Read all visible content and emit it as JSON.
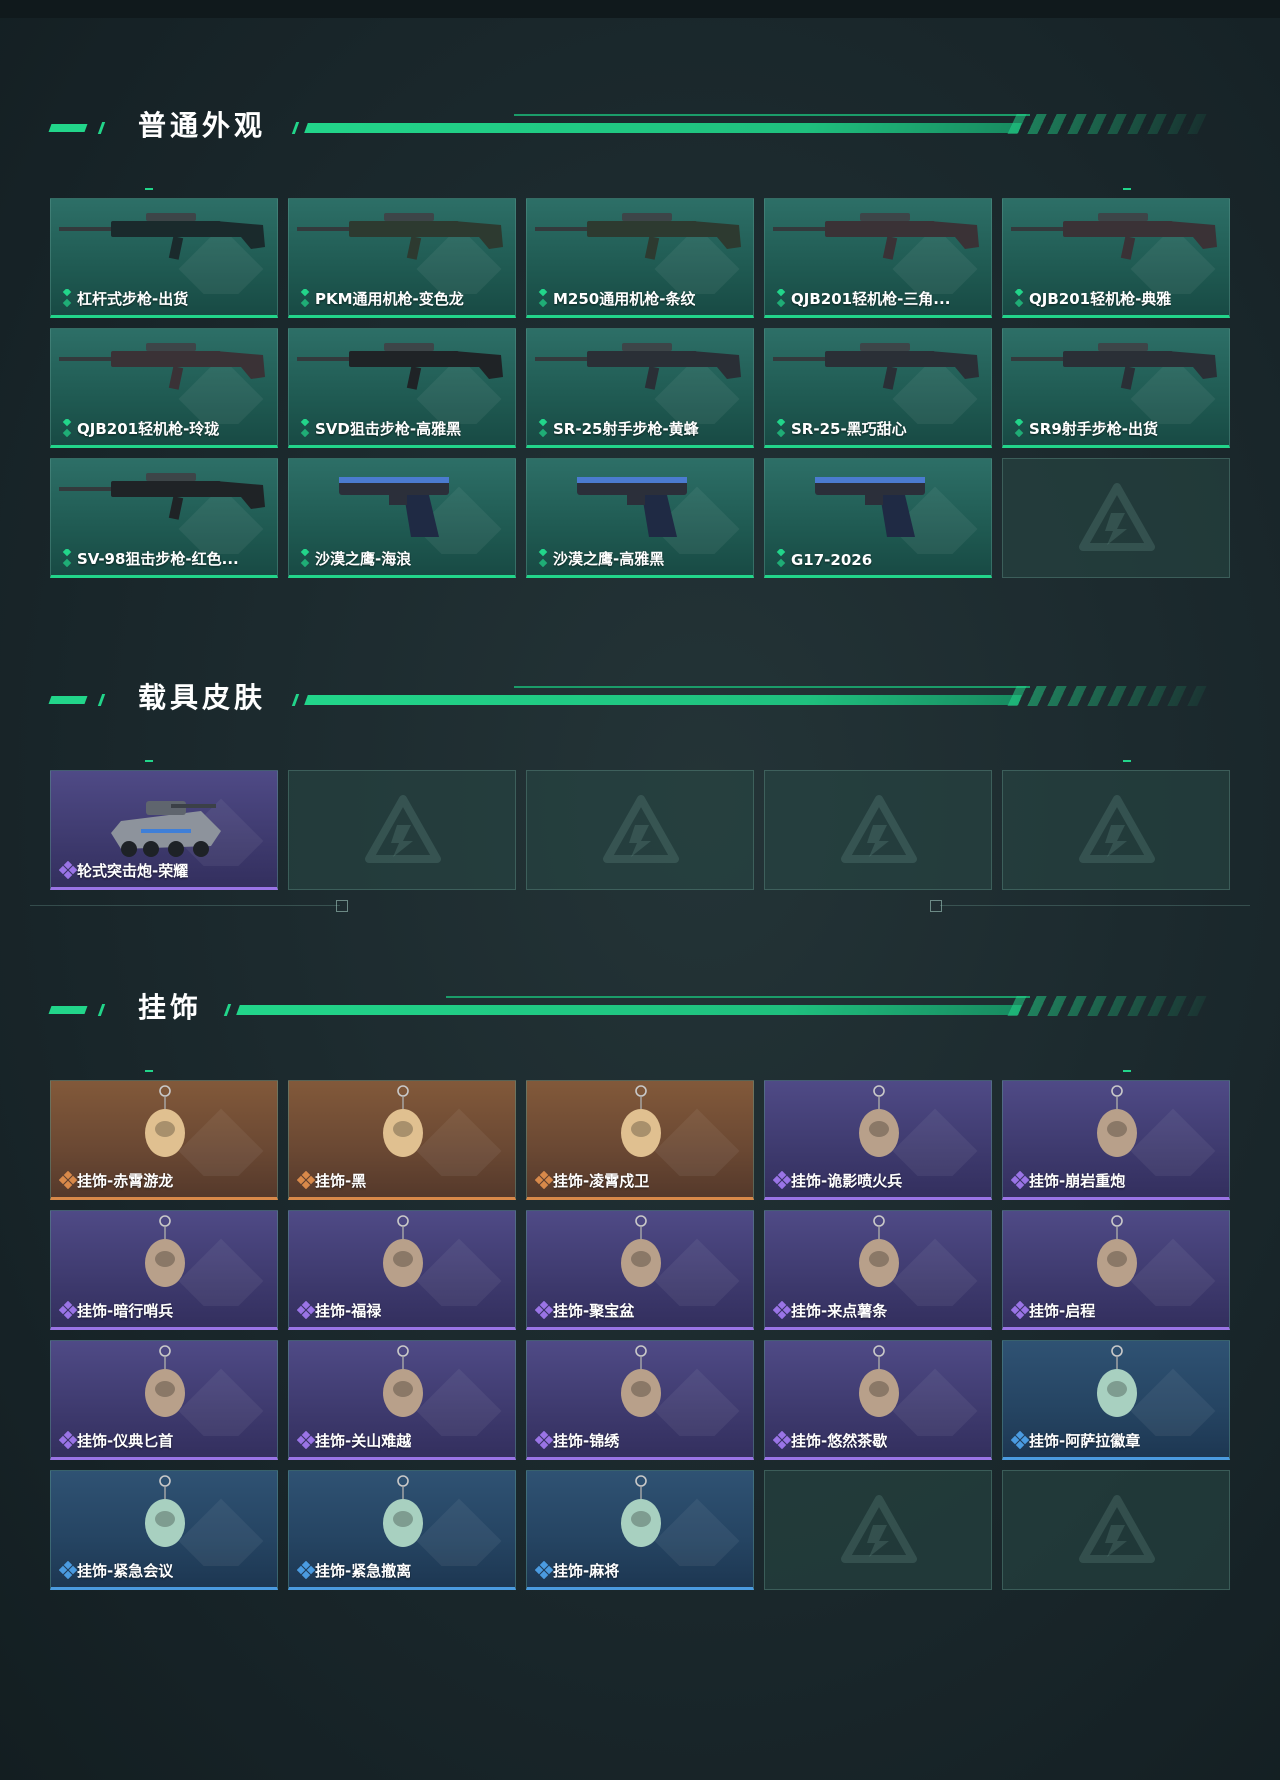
{
  "sections": [
    {
      "title": "普通外观",
      "items": [
        {
          "label": "杠杆式步枪-出货",
          "rarity": "green",
          "icon": "lever-rifle-icon"
        },
        {
          "label": "PKM通用机枪-变色龙",
          "rarity": "green",
          "icon": "machine-gun-icon"
        },
        {
          "label": "M250通用机枪-条纹",
          "rarity": "green",
          "icon": "machine-gun-icon"
        },
        {
          "label": "QJB201轻机枪-三角...",
          "rarity": "green",
          "icon": "light-machine-gun-icon"
        },
        {
          "label": "QJB201轻机枪-典雅",
          "rarity": "green",
          "icon": "light-machine-gun-icon"
        },
        {
          "label": "QJB201轻机枪-玲珑",
          "rarity": "green",
          "icon": "light-machine-gun-icon"
        },
        {
          "label": "SVD狙击步枪-高雅黑",
          "rarity": "green",
          "icon": "sniper-rifle-icon"
        },
        {
          "label": "SR-25射手步枪-黄蜂",
          "rarity": "green",
          "icon": "marksman-rifle-icon"
        },
        {
          "label": "SR-25-黑巧甜心",
          "rarity": "green",
          "icon": "marksman-rifle-icon"
        },
        {
          "label": "SR9射手步枪-出货",
          "rarity": "green",
          "icon": "marksman-rifle-icon"
        },
        {
          "label": "SV-98狙击步枪-红色...",
          "rarity": "green",
          "icon": "sniper-rifle-icon"
        },
        {
          "label": "沙漠之鹰-海浪",
          "rarity": "green",
          "icon": "pistol-icon"
        },
        {
          "label": "沙漠之鹰-高雅黑",
          "rarity": "green",
          "icon": "pistol-icon"
        },
        {
          "label": "G17-2026",
          "rarity": "green",
          "icon": "pistol-icon"
        }
      ],
      "empty_slots": 1
    },
    {
      "title": "载具皮肤",
      "items": [
        {
          "label": "轮式突击炮-荣耀",
          "rarity": "purple",
          "icon": "armored-vehicle-icon"
        }
      ],
      "empty_slots": 4
    },
    {
      "title": "挂饰",
      "items": [
        {
          "label": "挂饰-赤霄游龙",
          "rarity": "orange",
          "icon": "charm-icon"
        },
        {
          "label": "挂饰-黑",
          "rarity": "orange",
          "icon": "charm-icon"
        },
        {
          "label": "挂饰-凌霄戍卫",
          "rarity": "orange",
          "icon": "charm-icon"
        },
        {
          "label": "挂饰-诡影喷火兵",
          "rarity": "purple",
          "icon": "charm-icon"
        },
        {
          "label": "挂饰-崩岩重炮",
          "rarity": "purple",
          "icon": "charm-icon"
        },
        {
          "label": "挂饰-暗行哨兵",
          "rarity": "purple",
          "icon": "charm-icon"
        },
        {
          "label": "挂饰-福禄",
          "rarity": "purple",
          "icon": "charm-icon"
        },
        {
          "label": "挂饰-聚宝盆",
          "rarity": "purple",
          "icon": "charm-icon"
        },
        {
          "label": "挂饰-来点薯条",
          "rarity": "purple",
          "icon": "charm-icon"
        },
        {
          "label": "挂饰-启程",
          "rarity": "purple",
          "icon": "charm-icon"
        },
        {
          "label": "挂饰-仪典匕首",
          "rarity": "purple",
          "icon": "charm-icon"
        },
        {
          "label": "挂饰-关山难越",
          "rarity": "purple",
          "icon": "charm-icon"
        },
        {
          "label": "挂饰-锦绣",
          "rarity": "purple",
          "icon": "charm-icon"
        },
        {
          "label": "挂饰-悠然茶歇",
          "rarity": "purple",
          "icon": "charm-icon"
        },
        {
          "label": "挂饰-阿萨拉徽章",
          "rarity": "blue",
          "icon": "charm-icon"
        },
        {
          "label": "挂饰-紧急会议",
          "rarity": "blue",
          "icon": "charm-icon"
        },
        {
          "label": "挂饰-紧急撤离",
          "rarity": "blue",
          "icon": "charm-icon"
        },
        {
          "label": "挂饰-麻将",
          "rarity": "blue",
          "icon": "charm-icon"
        }
      ],
      "empty_slots": 2
    }
  ],
  "colors": {
    "accent": "#22d58a",
    "green": "#22d58a",
    "purple": "#9a74e6",
    "orange": "#d8894a",
    "blue": "#4b9be0"
  }
}
